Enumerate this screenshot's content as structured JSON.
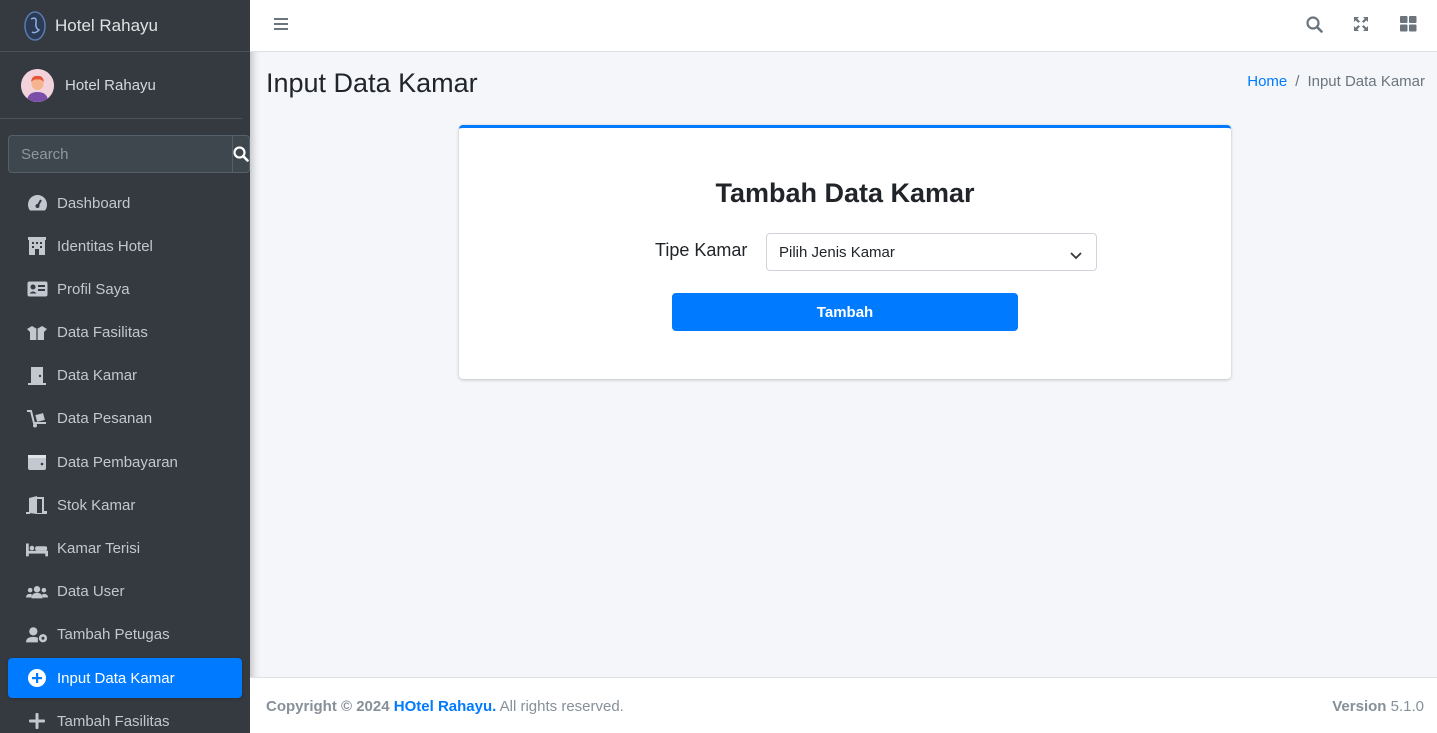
{
  "brand": {
    "name": "Hotel Rahayu",
    "icon": "brand-logo-icon"
  },
  "user": {
    "name": "Hotel Rahayu",
    "icon": "user-avatar"
  },
  "search": {
    "placeholder": "Search",
    "icon": "search-icon"
  },
  "sidebar": {
    "items": [
      {
        "label": "Dashboard",
        "icon": "tachometer-icon"
      },
      {
        "label": "Identitas Hotel",
        "icon": "building-icon"
      },
      {
        "label": "Profil Saya",
        "icon": "id-card-icon"
      },
      {
        "label": "Data Fasilitas",
        "icon": "box-open-icon"
      },
      {
        "label": "Data Kamar",
        "icon": "door-closed-icon"
      },
      {
        "label": "Data Pesanan",
        "icon": "dolly-icon"
      },
      {
        "label": "Data Pembayaran",
        "icon": "wallet-icon"
      },
      {
        "label": "Stok Kamar",
        "icon": "door-open-icon"
      },
      {
        "label": "Kamar Terisi",
        "icon": "bed-icon"
      },
      {
        "label": "Data User",
        "icon": "users-icon"
      },
      {
        "label": "Tambah Petugas",
        "icon": "user-cog-icon"
      },
      {
        "label": "Input Data Kamar",
        "icon": "plus-circle-icon",
        "active": true
      },
      {
        "label": "Tambah Fasilitas",
        "icon": "plus-icon"
      }
    ]
  },
  "topbar": {
    "icons": [
      "bars-icon",
      "search-icon",
      "expand-icon",
      "th-large-icon"
    ]
  },
  "header": {
    "title": "Input Data Kamar"
  },
  "breadcrumb": {
    "home": "Home",
    "separator": "/",
    "current": "Input Data Kamar"
  },
  "form": {
    "title": "Tambah Data Kamar",
    "label": "Tipe Kamar",
    "select_value": "Pilih Jenis Kamar",
    "submit_label": "Tambah"
  },
  "footer": {
    "copyright": "Copyright © 2024",
    "brand": "HOtel Rahayu.",
    "rights": "All rights reserved.",
    "version_label": "Version",
    "version": "5.1.0"
  },
  "colors": {
    "primary": "#007bff",
    "sidebar": "#343a40",
    "background": "#f4f6f9"
  }
}
